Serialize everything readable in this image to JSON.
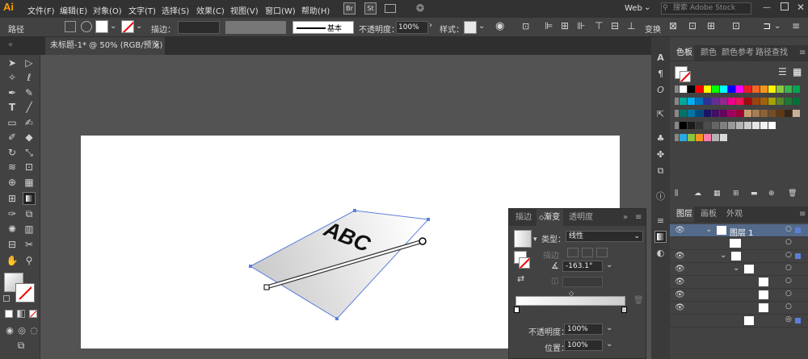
{
  "app": {
    "logo": "Ai",
    "menus": [
      "文件(F)",
      "编辑(E)",
      "对象(O)",
      "文字(T)",
      "选择(S)",
      "效果(C)",
      "视图(V)",
      "窗口(W)",
      "帮助(H)"
    ],
    "badges": [
      "Br",
      "St"
    ],
    "workspace": "Web",
    "search_placeholder": "搜索 Adobe Stock"
  },
  "control_bar": {
    "object_type": "路径",
    "stroke_label": "描边：",
    "stroke_style": "基本",
    "opacity_label": "不透明度：",
    "opacity_value": "100%",
    "style_label": "样式：",
    "transform_label": "变换"
  },
  "document": {
    "tab_title": "未标题-1* @ 50% (RGB/预览)",
    "close": "×"
  },
  "artwork": {
    "text": "ABC",
    "gradient_from": "#ffffff",
    "gradient_to": "#c8c8c8",
    "selection_color": "#5b7fdb"
  },
  "gradient_panel": {
    "tabs": [
      "描边",
      "渐变",
      "透明度"
    ],
    "active_tab": "渐变",
    "type_label": "类型：",
    "type_value": "线性",
    "stroke_label": "描边",
    "angle_value": "-163.1°",
    "opacity_label": "不透明度：",
    "opacity_value": "100%",
    "location_label": "位置：",
    "location_value": "100%"
  },
  "swatches_panel": {
    "tabs": [
      "色板",
      "颜色",
      "颜色参考",
      "路径查找"
    ],
    "active_tab": "色板",
    "rows": [
      [
        "#ffffff",
        "#000000",
        "#ff0000",
        "#ffff00",
        "#00ff00",
        "#00ffff",
        "#0000ff",
        "#ff00ff",
        "#ed1c24",
        "#f26522",
        "#f7941d",
        "#fff200",
        "#8dc63f",
        "#39b54a",
        "#00a651"
      ],
      [
        "#00a99d",
        "#00aeef",
        "#0072bc",
        "#2e3192",
        "#662d91",
        "#92278f",
        "#ec008c",
        "#ed145b",
        "#9e0b0f",
        "#a0410d",
        "#a3620a",
        "#aba000",
        "#598527",
        "#1a7b30",
        "#007236"
      ],
      [
        "#00746b",
        "#0076a3",
        "#004a80",
        "#1b1464",
        "#440e62",
        "#630460",
        "#9e005d",
        "#9e0039",
        "#c69c6d",
        "#a67c52",
        "#8c6239",
        "#754c24",
        "#603913",
        "#3c2415",
        "#c7b299"
      ],
      [
        "#000000",
        "#1a1a1a",
        "#333333",
        "#4d4d4d",
        "#666666",
        "#808080",
        "#999999",
        "#b3b3b3",
        "#cccccc",
        "#e6e6e6",
        "#f2f2f2",
        "#ffffff"
      ],
      [
        "#29abe2",
        "#8cc63f",
        "#f7931e",
        "#ff7bac",
        "#b3b3b3",
        "#d9d9d9"
      ]
    ]
  },
  "layers_panel": {
    "tabs": [
      "图层",
      "画板",
      "外观"
    ],
    "active_tab": "图层",
    "layer_name": "图层 1"
  }
}
